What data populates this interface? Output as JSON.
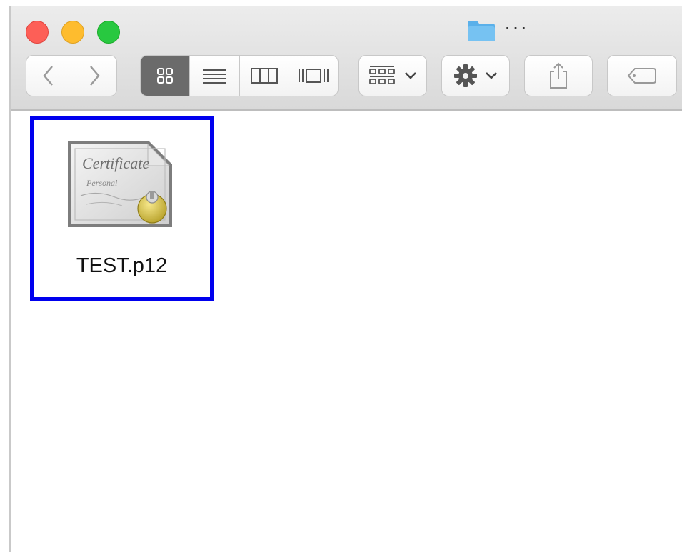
{
  "window": {
    "title_icon": "folder-icon",
    "title_more": "···"
  },
  "toolbar": {
    "traffic_lights": {
      "close": "#fd5f57",
      "minimize": "#febc2e",
      "maximize": "#28c840"
    },
    "nav": {
      "back_icon": "chevron-left-icon",
      "forward_icon": "chevron-right-icon"
    },
    "view_modes": [
      {
        "icon": "icon-view-icon",
        "active": true
      },
      {
        "icon": "list-view-icon",
        "active": false
      },
      {
        "icon": "column-view-icon",
        "active": false
      },
      {
        "icon": "gallery-view-icon",
        "active": false
      }
    ],
    "group_button_icon": "group-by-icon",
    "action_button_icon": "gear-icon",
    "share_button_icon": "share-icon",
    "tag_button_icon": "tag-icon"
  },
  "files": [
    {
      "name": "TEST.p12",
      "icon": "certificate-icon",
      "selected": true
    }
  ],
  "colors": {
    "selection_outline": "#0000ee",
    "folder": "#5ab0ea"
  }
}
